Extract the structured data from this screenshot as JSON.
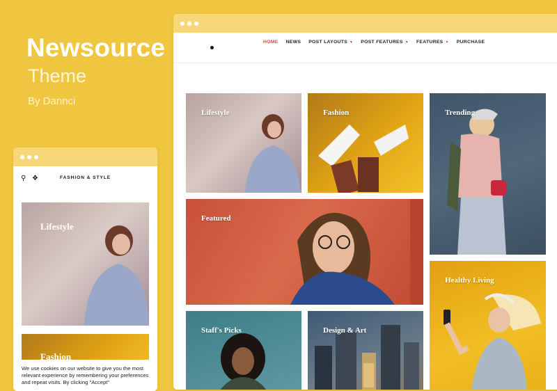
{
  "hero": {
    "title": "Newsource",
    "subtitle": "Theme",
    "byline": "By Dannci"
  },
  "desktop": {
    "nav": [
      {
        "label": "HOME",
        "active": true,
        "dropdown": false
      },
      {
        "label": "NEWS",
        "active": false,
        "dropdown": false
      },
      {
        "label": "POST LAYOUTS",
        "active": false,
        "dropdown": true
      },
      {
        "label": "POST FEATURES",
        "active": false,
        "dropdown": true
      },
      {
        "label": "FEATURES",
        "active": false,
        "dropdown": true
      },
      {
        "label": "PURCHASE",
        "active": false,
        "dropdown": false
      }
    ],
    "tiles": {
      "lifestyle": "Lifestyle",
      "fashion": "Fashion",
      "trending": "Trending",
      "featured": "Featured",
      "healthy_living": "Healthy Living",
      "staffs_picks": "Staff's Picks",
      "design_art": "Design & Art"
    }
  },
  "mobile": {
    "brand": "FASHION & STYLE",
    "tile1": "Lifestyle",
    "tile2": "Fashion",
    "cookie_text": "We use cookies on our website to give you the most relevant experience by remembering your preferences and repeat visits. By clicking \"Accept\""
  },
  "colors": {
    "background": "#f0c640",
    "accent": "#e0452a",
    "titlebar": "#f7d778"
  }
}
